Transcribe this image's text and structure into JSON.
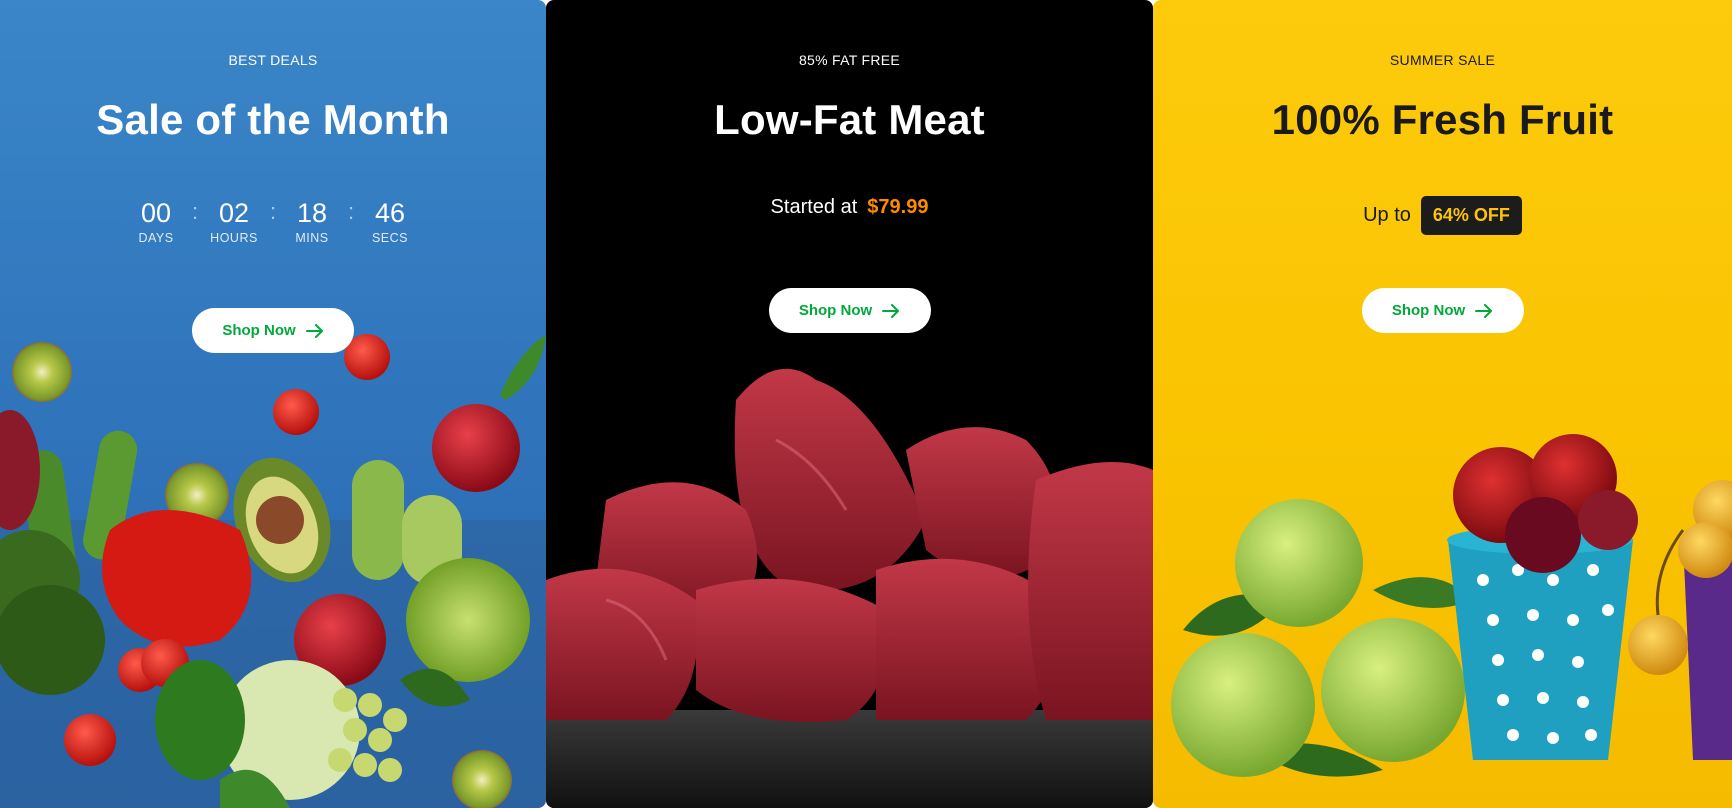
{
  "banners": [
    {
      "eyebrow": "BEST DEALS",
      "title": "Sale of the Month",
      "countdown": [
        {
          "value": "00",
          "label": "DAYS"
        },
        {
          "value": "02",
          "label": "HOURS"
        },
        {
          "value": "18",
          "label": "MINS"
        },
        {
          "value": "46",
          "label": "SECS"
        }
      ],
      "separator": ":",
      "button_label": "Shop Now",
      "background": "#3a86c8"
    },
    {
      "eyebrow": "85% FAT FREE",
      "title": "Low-Fat Meat",
      "price_prefix": "Started at",
      "price": "$79.99",
      "button_label": "Shop Now",
      "background": "#000000"
    },
    {
      "eyebrow": "SUMMER SALE",
      "title": "100% Fresh Fruit",
      "offer_prefix": "Up to",
      "offer_badge": "64% OFF",
      "button_label": "Shop Now",
      "background": "#fcc30c"
    }
  ],
  "colors": {
    "accent_green": "#00a93a",
    "price_orange": "#ff8a00",
    "badge_bg": "#1c1c1c"
  },
  "icons": {
    "button_icon": "arrow-right-icon"
  }
}
